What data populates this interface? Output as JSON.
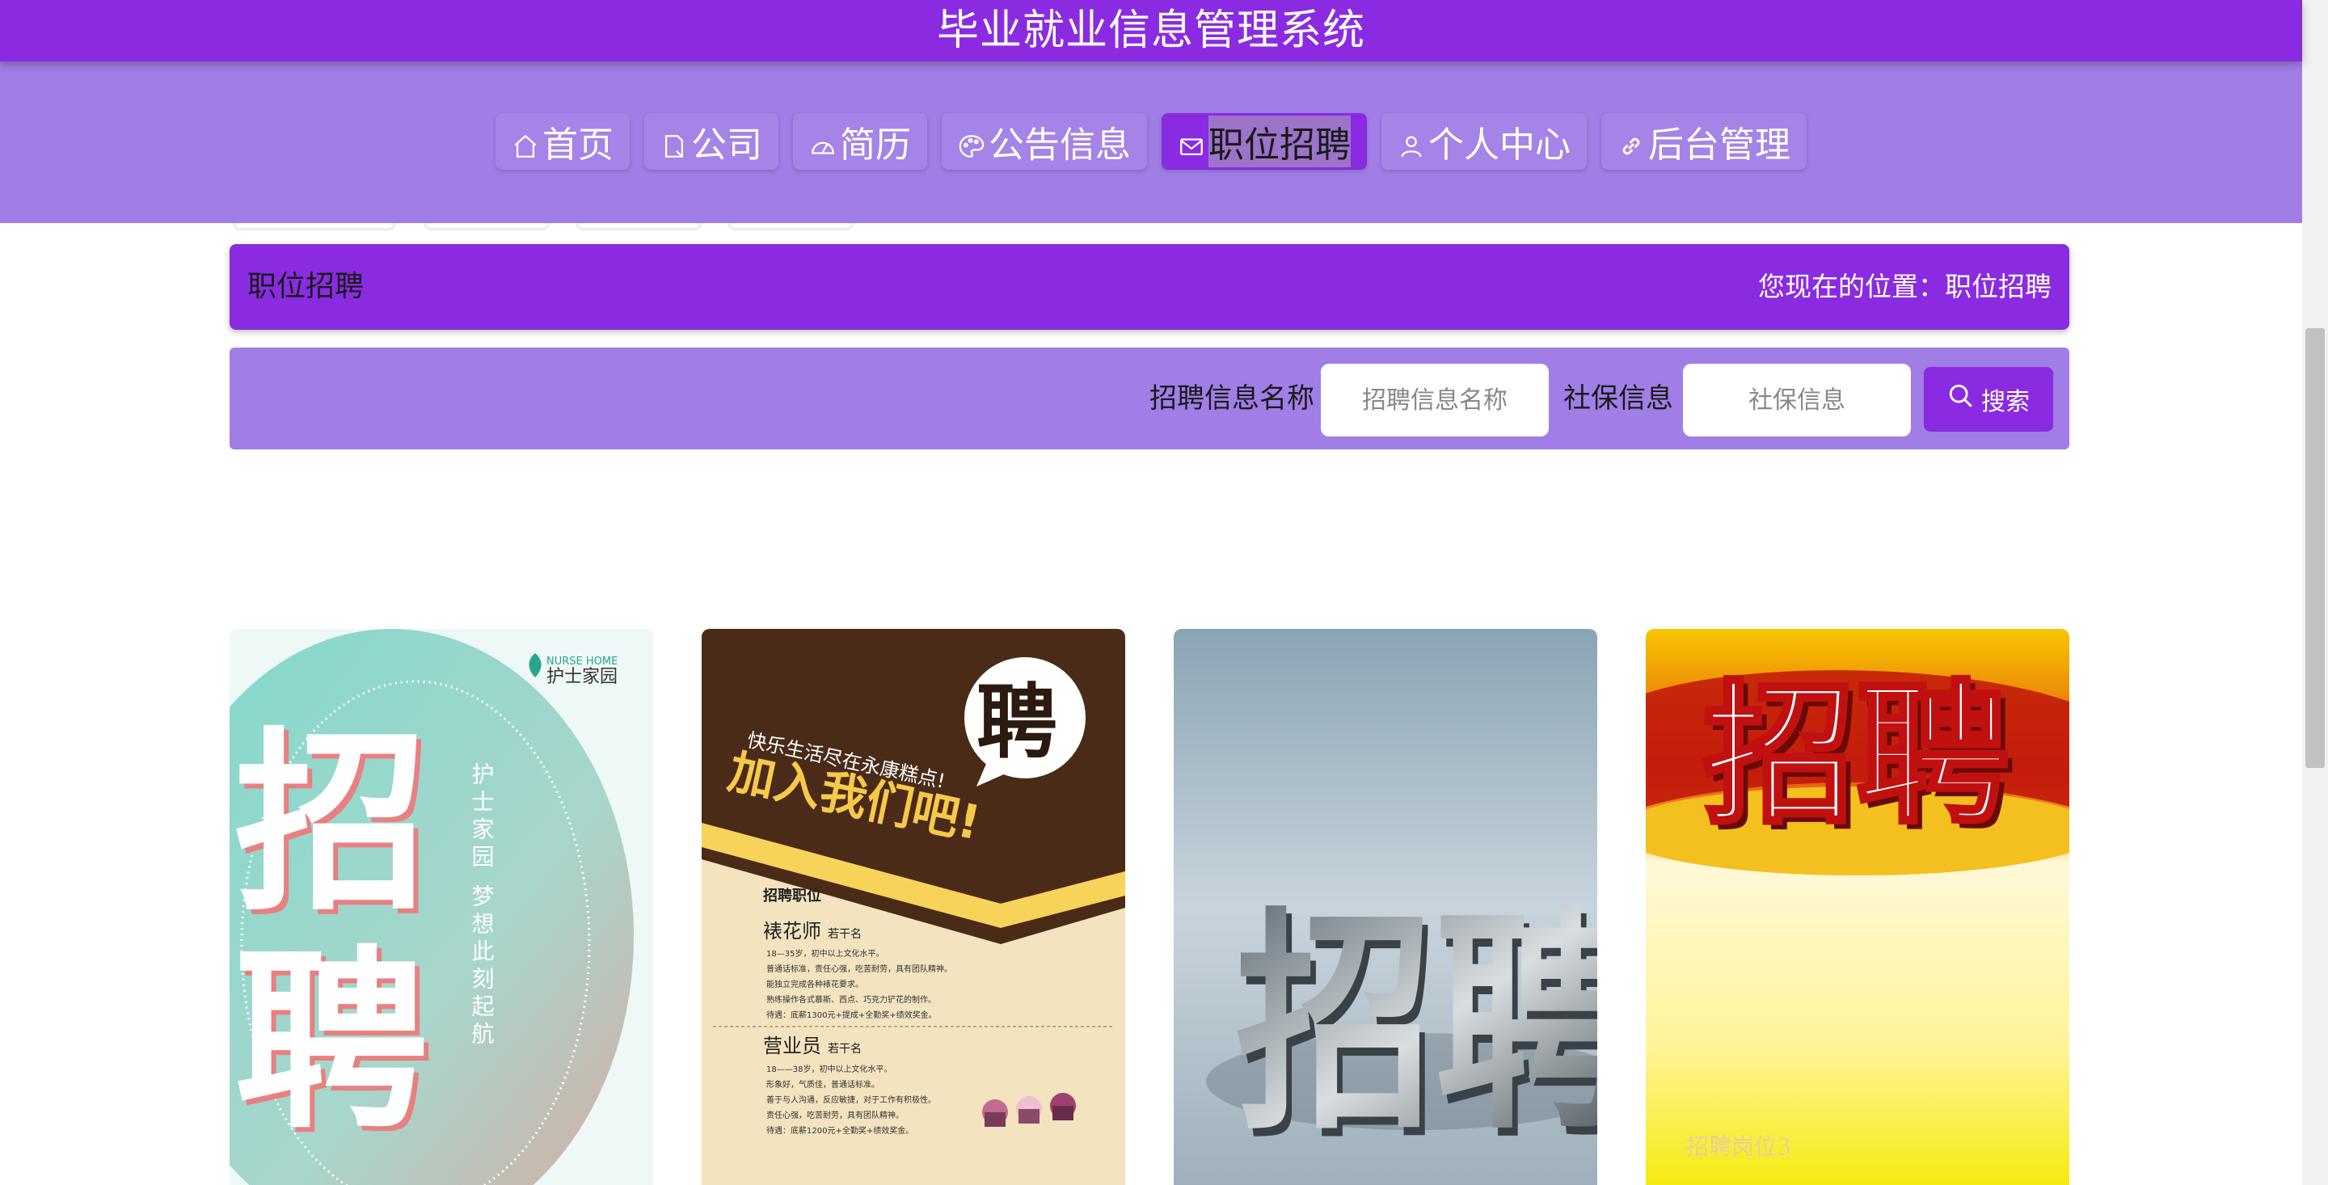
{
  "app": {
    "title": "毕业就业信息管理系统"
  },
  "nav": {
    "items": [
      {
        "label": "首页",
        "icon": "home-icon"
      },
      {
        "label": "公司",
        "icon": "document-icon"
      },
      {
        "label": "简历",
        "icon": "gauge-icon"
      },
      {
        "label": "公告信息",
        "icon": "palette-icon"
      },
      {
        "label": "职位招聘",
        "icon": "mail-icon",
        "active": true
      },
      {
        "label": "个人中心",
        "icon": "user-icon"
      },
      {
        "label": "后台管理",
        "icon": "link-icon"
      }
    ]
  },
  "header": {
    "page_title": "职位招聘",
    "location": "您现在的位置：职位招聘"
  },
  "search": {
    "name_label": "招聘信息名称",
    "name_placeholder": "招聘信息名称",
    "social_label": "社保信息",
    "social_placeholder": "社保信息",
    "button_label": "搜索"
  },
  "cards": [
    {
      "big_text_1": "招",
      "big_text_2": "聘",
      "logo_en": "NURSE HOME",
      "logo_cn": "护士家园",
      "vertical_text": "护士家园 梦想此刻起航"
    },
    {
      "badge": "聘",
      "slogan": "快乐生活尽在永康糕点!",
      "headline": "加入我们吧!",
      "section_title": "招聘职位",
      "job1_title": "裱花师",
      "job1_count": "若干名",
      "job1_lines": [
        "18—35岁，初中以上文化水平。",
        "普通话标准，责任心强，吃苦耐劳，具有团队精神。",
        "能独立完成各种裱花要求。",
        "熟练操作各式慕斯、西点、巧克力铲花的制作。",
        "待遇：底薪1300元+提成+全勤奖+绩效奖金。"
      ],
      "job2_title": "营业员",
      "job2_count": "若干名",
      "job2_lines": [
        "18——38岁，初中以上文化水平。",
        "形象好，气质佳，普通话标准。",
        "善于与人沟通，反应敏捷，对于工作有积极性。",
        "责任心强，吃苦耐劳，具有团队精神。",
        "待遇：底薪1200元+全勤奖+绩效奖金。"
      ]
    },
    {
      "big_text": "招聘"
    },
    {
      "big_text": "招聘",
      "caption": "招聘岗位3"
    }
  ]
}
